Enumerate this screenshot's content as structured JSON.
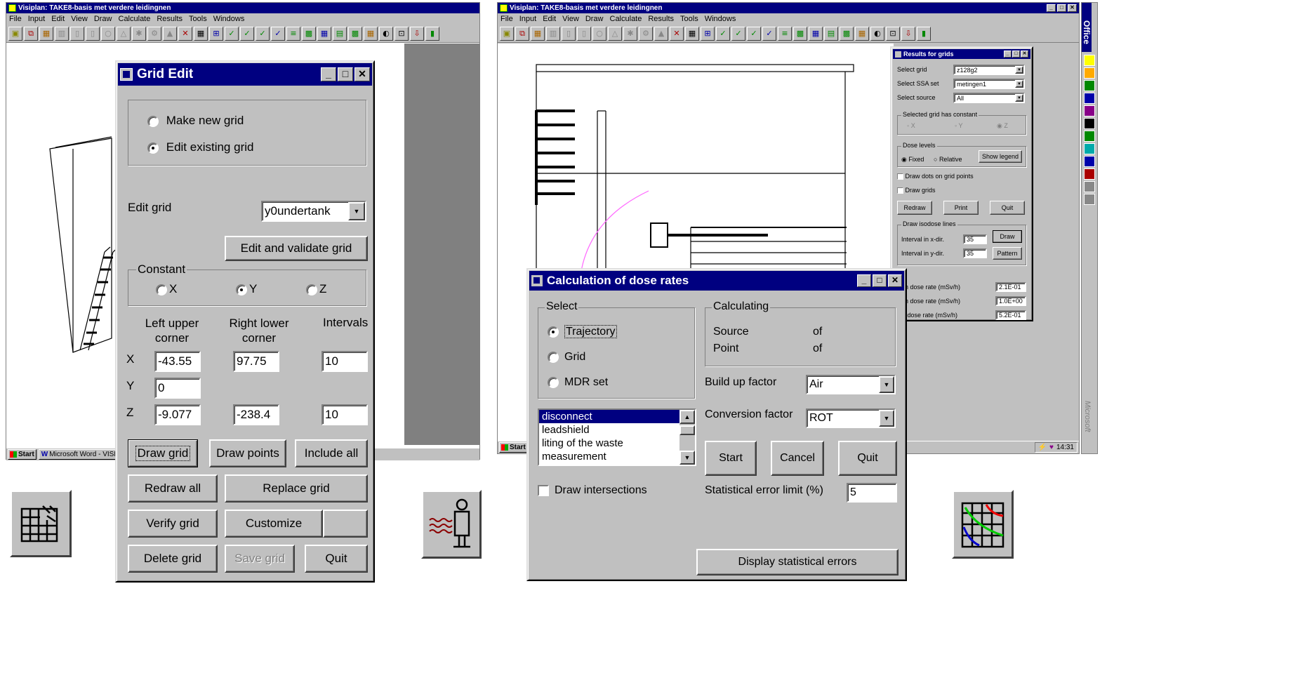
{
  "left_app": {
    "title": "Visiplan: TAKE8-basis met verdere leidingnen",
    "menu": [
      "File",
      "Input",
      "Edit",
      "View",
      "Draw",
      "Calculate",
      "Results",
      "Tools",
      "Windows"
    ]
  },
  "right_app": {
    "title": "Visiplan: TAKE8-basis met verdere leidingnen",
    "menu": [
      "File",
      "Input",
      "Edit",
      "View",
      "Draw",
      "Calculate",
      "Results",
      "Tools",
      "Windows"
    ]
  },
  "taskbar": {
    "start": "Start",
    "word_task": "Microsoft Word - VISI",
    "clock": "14:31"
  },
  "office_bar": {
    "label": "Office",
    "brand": "Microsoft"
  },
  "grid_edit": {
    "title": "Grid Edit",
    "radio_new": "Make new grid",
    "radio_existing": "Edit existing grid",
    "edit_grid_label": "Edit grid",
    "edit_grid_value": "y0undertank",
    "edit_validate": "Edit and validate grid",
    "constant_label": "Constant",
    "const_x": "X",
    "const_y": "Y",
    "const_z": "Z",
    "col_left": "Left upper corner",
    "col_right": "Right lower corner",
    "col_intervals": "Intervals",
    "row_x": "X",
    "row_y": "Y",
    "row_z": "Z",
    "x_left": "-43.55",
    "x_right": "97.75",
    "x_int": "10",
    "y_left": "0",
    "z_left": "-9.077",
    "z_right": "-238.4",
    "z_int": "10",
    "draw_grid": "Draw grid",
    "draw_points": "Draw points",
    "include_all": "Include all",
    "redraw_all": "Redraw all",
    "replace_grid": "Replace grid",
    "verify_grid": "Verify grid",
    "customize": "Customize",
    "delete_grid": "Delete grid",
    "save_grid": "Save grid",
    "quit": "Quit"
  },
  "results": {
    "title": "Results for grids",
    "select_grid": "Select grid",
    "select_grid_val": "z128g2",
    "select_ssa": "Select SSA set",
    "select_ssa_val": "metingen1",
    "select_source": "Select source",
    "select_source_val": "All",
    "constant_group": "Selected grid has constant",
    "cx": "X",
    "cy": "Y",
    "cz": "Z",
    "dose_levels": "Dose levels",
    "fixed": "Fixed",
    "relative": "Relative",
    "show_legend": "Show legend",
    "draw_dots": "Draw dots on grid points",
    "draw_grids": "Draw grids",
    "redraw": "Redraw",
    "print": "Print",
    "quit": "Quit",
    "isodose_group": "Draw isodose lines",
    "int_x": "Interval in x-dir.",
    "int_x_val": "35",
    "int_y": "Interval in y-dir.",
    "int_y_val": "35",
    "draw": "Draw",
    "pattern": "Pattern",
    "min_dose": "imum dose rate (mSv/h)",
    "min_val": "2.1E-01",
    "max_dose": "imum dose rate (mSv/h)",
    "max_val": "1.0E+00",
    "avg_dose": "rage dose rate (mSv/h)",
    "avg_val": "5.2E-01"
  },
  "calc": {
    "title": "Calculation of dose rates",
    "select_group": "Select",
    "trajectory": "Trajectory",
    "grid": "Grid",
    "mdr": "MDR set",
    "calculating": "Calculating",
    "source": "Source",
    "point": "Point",
    "of1": "of",
    "of2": "of",
    "buildup_label": "Build up factor",
    "buildup_val": "Air",
    "conversion_label": "Conversion factor",
    "conversion_val": "ROT",
    "list": [
      "disconnect",
      "leadshield",
      "liting of the waste",
      "measurement"
    ],
    "start": "Start",
    "cancel": "Cancel",
    "quit": "Quit",
    "draw_intersections": "Draw intersections",
    "stat_label": "Statistical error limit (%)",
    "stat_val": "5",
    "display_errors": "Display statistical errors"
  }
}
